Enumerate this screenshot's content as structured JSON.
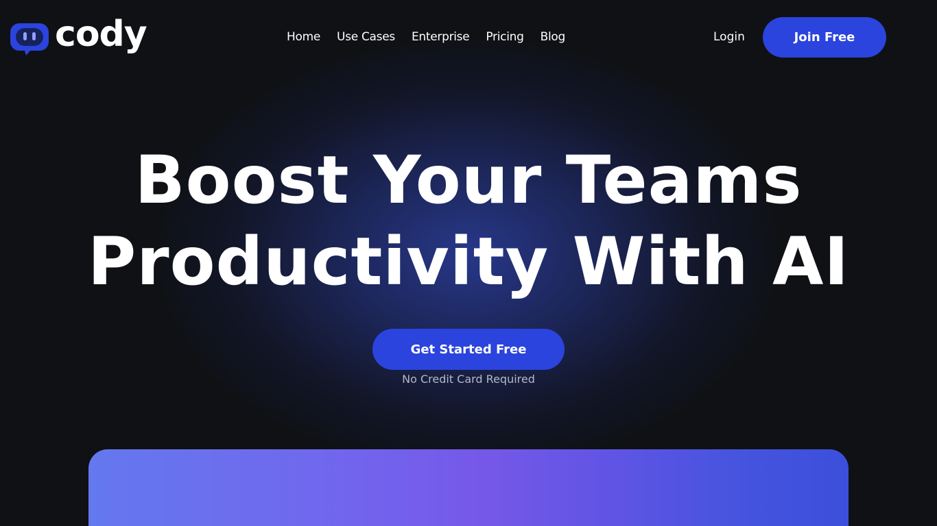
{
  "brand": {
    "name": "cody",
    "accent_color": "#2b44dd",
    "icon": "chat-bubble-robot-icon"
  },
  "nav": {
    "items": [
      {
        "label": "Home"
      },
      {
        "label": "Use Cases"
      },
      {
        "label": "Enterprise"
      },
      {
        "label": "Pricing"
      },
      {
        "label": "Blog"
      }
    ]
  },
  "header_actions": {
    "login_label": "Login",
    "join_label": "Join Free"
  },
  "hero": {
    "title_line1": "Boost Your Teams",
    "title_line2": "Productivity With AI",
    "cta_label": "Get Started Free",
    "cta_note": "No Credit Card Required"
  },
  "colors": {
    "background": "#0f1114",
    "glow": "#2e42aa",
    "preview_gradient_start": "#6478ef",
    "preview_gradient_end": "#3b4fdc"
  }
}
